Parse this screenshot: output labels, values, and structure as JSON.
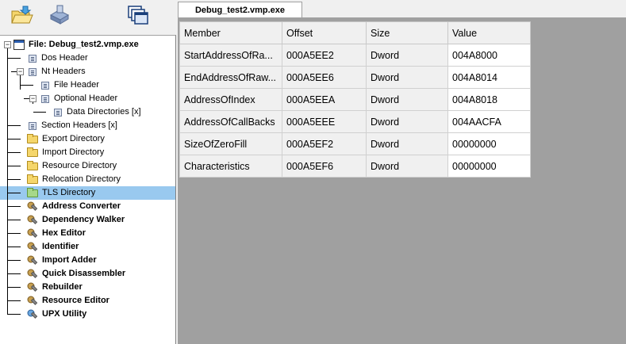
{
  "toolbar": {
    "buttons": [
      {
        "name": "open-file-icon",
        "label": ""
      },
      {
        "name": "save-icon",
        "label": ""
      },
      {
        "name": "windows-icon",
        "label": ""
      }
    ]
  },
  "tab": {
    "label": "Debug_test2.vmp.exe"
  },
  "tree": {
    "root_label": "File: Debug_test2.vmp.exe",
    "items": [
      {
        "label": "Dos Header"
      },
      {
        "label": "Nt Headers"
      },
      {
        "label": "File Header"
      },
      {
        "label": "Optional Header"
      },
      {
        "label": "Data Directories [x]"
      },
      {
        "label": "Section Headers [x]"
      },
      {
        "label": "Export Directory"
      },
      {
        "label": "Import Directory"
      },
      {
        "label": "Resource Directory"
      },
      {
        "label": "Relocation Directory"
      },
      {
        "label": "TLS Directory"
      },
      {
        "label": "Address Converter"
      },
      {
        "label": "Dependency Walker"
      },
      {
        "label": "Hex Editor"
      },
      {
        "label": "Identifier"
      },
      {
        "label": "Import Adder"
      },
      {
        "label": "Quick Disassembler"
      },
      {
        "label": "Rebuilder"
      },
      {
        "label": "Resource Editor"
      },
      {
        "label": "UPX Utility"
      }
    ]
  },
  "table": {
    "headers": [
      "Member",
      "Offset",
      "Size",
      "Value"
    ],
    "rows": [
      [
        "StartAddressOfRa...",
        "000A5EE2",
        "Dword",
        "004A8000"
      ],
      [
        "EndAddressOfRaw...",
        "000A5EE6",
        "Dword",
        "004A8014"
      ],
      [
        "AddressOfIndex",
        "000A5EEA",
        "Dword",
        "004A8018"
      ],
      [
        "AddressOfCallBacks",
        "000A5EEE",
        "Dword",
        "004AACFA"
      ],
      [
        "SizeOfZeroFill",
        "000A5EF2",
        "Dword",
        "00000000"
      ],
      [
        "Characteristics",
        "000A5EF6",
        "Dword",
        "00000000"
      ]
    ]
  }
}
